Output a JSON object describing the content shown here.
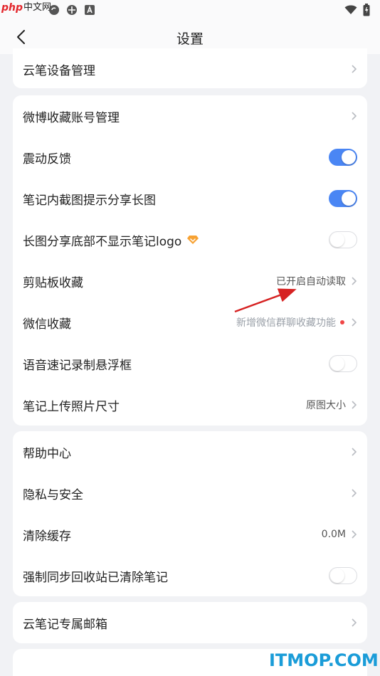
{
  "watermark_top": {
    "brand": "php",
    "site": "中文网"
  },
  "header": {
    "title": "设置"
  },
  "cards": [
    {
      "rows": [
        {
          "label": "云笔设备管理",
          "control": "chevron"
        }
      ]
    },
    {
      "rows": [
        {
          "label": "微博收藏账号管理",
          "control": "chevron"
        },
        {
          "label": "震动反馈",
          "control": "toggle",
          "on": true
        },
        {
          "label": "笔记内截图提示分享长图",
          "control": "toggle",
          "on": true
        },
        {
          "label": "长图分享底部不显示笔记logo",
          "control": "toggle",
          "on": false,
          "badge": "vip-icon"
        },
        {
          "label": "剪贴板收藏",
          "control": "chevron",
          "value": "已开启自动读取"
        },
        {
          "label": "微信收藏",
          "control": "chevron",
          "value": "新增微信群聊收藏功能",
          "dot": true
        },
        {
          "label": "语音速记录制悬浮框",
          "control": "toggle",
          "on": false
        },
        {
          "label": "笔记上传照片尺寸",
          "control": "chevron",
          "value": "原图大小"
        }
      ]
    },
    {
      "rows": [
        {
          "label": "帮助中心",
          "control": "chevron"
        },
        {
          "label": "隐私与安全",
          "control": "chevron"
        },
        {
          "label": "清除缓存",
          "control": "chevron",
          "value": "0.0M"
        },
        {
          "label": "强制同步回收站已清除笔记",
          "control": "toggle",
          "on": false
        }
      ]
    },
    {
      "rows": [
        {
          "label": "云笔记专属邮箱",
          "control": "chevron"
        }
      ]
    }
  ],
  "colors": {
    "accent": "#4a86f4",
    "background": "#f1f2f5",
    "dot": "#f04545",
    "annotation_arrow": "#d62222"
  },
  "watermark_bottom": "ITMOP.COM"
}
